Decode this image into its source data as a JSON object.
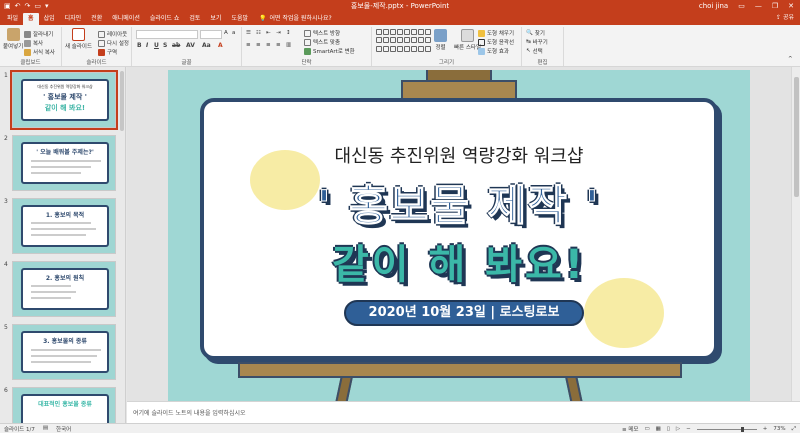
{
  "app": {
    "window_title": "홍보물-제작.pptx  -  PowerPoint",
    "user": "choi jina",
    "qat_icons": [
      "save-icon",
      "undo-icon",
      "redo-icon",
      "start-from-beginning-icon",
      "customize-qat-icon"
    ],
    "colors": {
      "accent": "#c43e1c",
      "ribbon": "#f3f3f3",
      "slide_bg": "#9fd7d4",
      "board_border": "#2f4a6e",
      "title_blue": "#2f5f97",
      "title_teal": "#3bb8a8"
    }
  },
  "tabs": [
    "파일",
    "홈",
    "삽입",
    "디자인",
    "전환",
    "애니메이션",
    "슬라이드 쇼",
    "검토",
    "보기",
    "도움말"
  ],
  "active_tab": "홈",
  "tell_me": "어떤 작업을 원하시나요?",
  "share_label": "공유",
  "ribbon": {
    "clipboard": {
      "label": "클립보드",
      "paste": "붙여넣기",
      "cut": "잘라내기",
      "copy": "복사",
      "format_painter": "서식 복사"
    },
    "slides": {
      "label": "슬라이드",
      "new_slide": "새 슬라이드",
      "layout": "레이아웃",
      "reset": "다시 설정",
      "section": "구역"
    },
    "font": {
      "label": "글꼴"
    },
    "paragraph": {
      "label": "단락",
      "text_direction": "텍스트 방향",
      "align_text": "텍스트 맞춤",
      "smartart": "SmartArt로 변환"
    },
    "drawing": {
      "label": "그리기",
      "arrange": "정렬",
      "quick_styles": "빠른 스타일",
      "shape_fill": "도형 채우기",
      "shape_outline": "도형 윤곽선",
      "shape_effects": "도형 효과"
    },
    "editing": {
      "label": "편집",
      "find": "찾기",
      "replace": "바꾸기",
      "select": "선택"
    }
  },
  "thumbnails": [
    {
      "num": "1",
      "small": "대신동 추진위원 역량강화 워크샵",
      "title": "' 홍보물 제작 '",
      "sub": "같이 해 봐요!"
    },
    {
      "num": "2",
      "small": "",
      "title": "' 오늘 배워볼 주제는?'",
      "sub": ""
    },
    {
      "num": "3",
      "small": "",
      "title": "1. 홍보의 목적",
      "sub": ""
    },
    {
      "num": "4",
      "small": "",
      "title": "2. 홍보의 원칙",
      "sub": ""
    },
    {
      "num": "5",
      "small": "",
      "title": "3. 홍보물의 종류",
      "sub": ""
    },
    {
      "num": "6",
      "small": "",
      "title": "대표적인 홍보물 종류",
      "sub": ""
    }
  ],
  "slide": {
    "subtitle": "대신동 추진위원 역량강화 워크샵",
    "title": "' 홍보물 제작 '",
    "title2": "같이 해 봐요!",
    "pill": "2020년 10월 23일  |  로스팅로보"
  },
  "notes_placeholder": "여기에 슬라이드 노트의 내용을 입력하십시오",
  "status": {
    "slide_counter": "슬라이드 1/7",
    "language": "한국어",
    "notes_btn": "메모",
    "zoom": "73%"
  }
}
